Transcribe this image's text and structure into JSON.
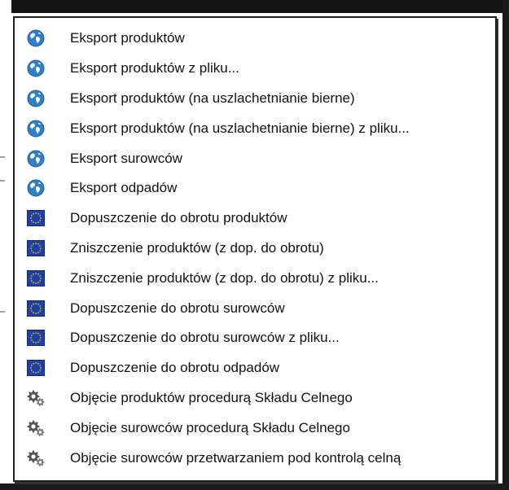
{
  "menu": {
    "items": [
      {
        "label": "Eksport produktów",
        "icon": "globe-icon"
      },
      {
        "label": "Eksport produktów z pliku...",
        "icon": "globe-icon"
      },
      {
        "label": "Eksport produktów (na uszlachetnianie bierne)",
        "icon": "globe-icon"
      },
      {
        "label": "Eksport produktów (na uszlachetnianie bierne) z pliku...",
        "icon": "globe-icon"
      },
      {
        "label": "Eksport surowców",
        "icon": "globe-icon"
      },
      {
        "label": "Eksport odpadów",
        "icon": "globe-icon"
      },
      {
        "label": "Dopuszczenie do obrotu produktów",
        "icon": "eu-flag-icon"
      },
      {
        "label": "Zniszczenie produktów (z dop. do obrotu)",
        "icon": "eu-flag-icon"
      },
      {
        "label": "Zniszczenie produktów (z dop. do obrotu) z pliku...",
        "icon": "eu-flag-icon"
      },
      {
        "label": "Dopuszczenie do obrotu surowców",
        "icon": "eu-flag-icon"
      },
      {
        "label": "Dopuszczenie do obrotu surowców z pliku...",
        "icon": "eu-flag-icon"
      },
      {
        "label": "Dopuszczenie do obrotu odpadów",
        "icon": "eu-flag-icon"
      },
      {
        "label": "Objęcie produktów procedurą Składu Celnego",
        "icon": "gears-icon"
      },
      {
        "label": "Objęcie surowców procedurą Składu Celnego",
        "icon": "gears-icon"
      },
      {
        "label": "Objęcie surowców przetwarzaniem pod kontrolą celną",
        "icon": "gears-icon"
      }
    ]
  },
  "colors": {
    "globe": "#2f80c8",
    "eu_blue": "#1d3fa8",
    "eu_star": "#f2c200",
    "gear": "#555555"
  }
}
